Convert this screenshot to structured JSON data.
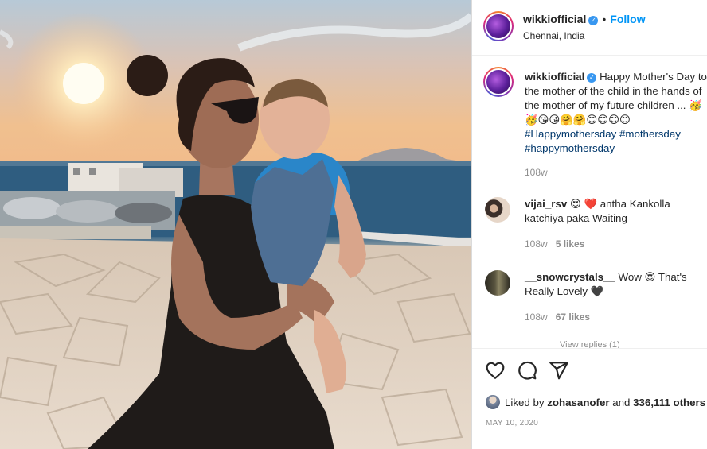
{
  "post": {
    "username": "wikkiofficial",
    "follow_label": "Follow",
    "separator": "•",
    "location": "Chennai, India"
  },
  "caption": {
    "username": "wikkiofficial",
    "text": "Happy Mother's Day to the mother of the child in the hands of the mother of my future children ... 🥳🥳😘😘🤗🤗😊😊😊😊",
    "hashtags": "#Happymothersday #mothersday #happymothersday",
    "time": "108w"
  },
  "comments": [
    {
      "username": "vijai_rsv",
      "text": "😍 ❤️ antha Kankolla katchiya paka Waiting",
      "time": "108w",
      "likes": "5 likes"
    },
    {
      "username": "__snowcrystals__",
      "text": "Wow 😍 That's Really Lovely 🖤",
      "time": "108w",
      "likes": "67 likes"
    }
  ],
  "view_replies": "View replies (1)",
  "actions": {
    "icons": [
      "heart-icon",
      "comment-icon",
      "share-icon"
    ],
    "liked_by_prefix": "Liked by",
    "liked_by_user": "zohasanofer",
    "liked_by_suffix": "and",
    "liked_by_count": "336,111 others",
    "date": "MAY 10, 2020"
  },
  "colors": {
    "link": "#0095f6",
    "hashtag": "#00376b",
    "meta": "#8e8e8e",
    "verified": "#3897f0"
  }
}
